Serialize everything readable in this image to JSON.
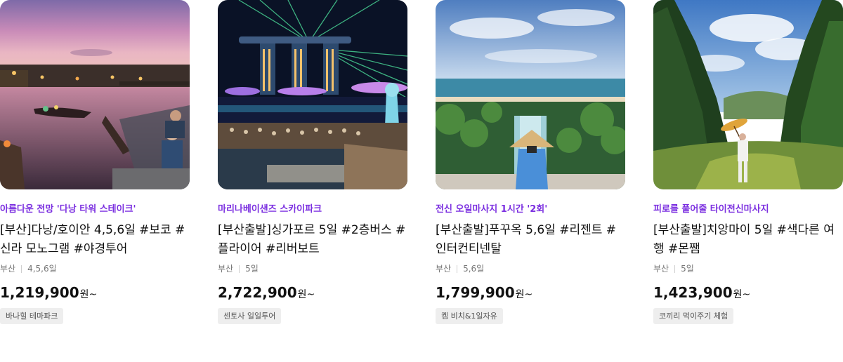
{
  "cards": [
    {
      "promo": "아름다운 전망 '다낭 타워 스테이크'",
      "title": "[부산]다낭/호이안 4,5,6일 #보코 #신라 모노그램 #야경투어",
      "origin": "부산",
      "duration": "4,5,6일",
      "price": "1,219,900",
      "currency": "원~",
      "tag": "바나힐 테마파크"
    },
    {
      "promo": "마리나베이샌즈 스카이파크",
      "title": "[부산출발]싱가포르 5일 #2층버스 #플라이어 #리버보트",
      "origin": "부산",
      "duration": "5일",
      "price": "2,722,900",
      "currency": "원~",
      "tag": "센토사 일일투어"
    },
    {
      "promo": "전신 오일마사지 1시간 '2회'",
      "title": "[부산출발]푸꾸옥 5,6일 #리젠트 #인터컨티넨탈",
      "origin": "부산",
      "duration": "5,6일",
      "price": "1,799,900",
      "currency": "원~",
      "tag": "켐 비치&1일자유"
    },
    {
      "promo": "피로를 풀어줄 타이전신마사지",
      "title": "[부산출발]치앙마이 5일 #색다른 여행 #몬쨈",
      "origin": "부산",
      "duration": "5일",
      "price": "1,423,900",
      "currency": "원~",
      "tag": "코끼리 먹이주기 체험"
    }
  ],
  "colors": {
    "promo": "#7b2fe0",
    "tag_bg": "#eeeeee"
  }
}
